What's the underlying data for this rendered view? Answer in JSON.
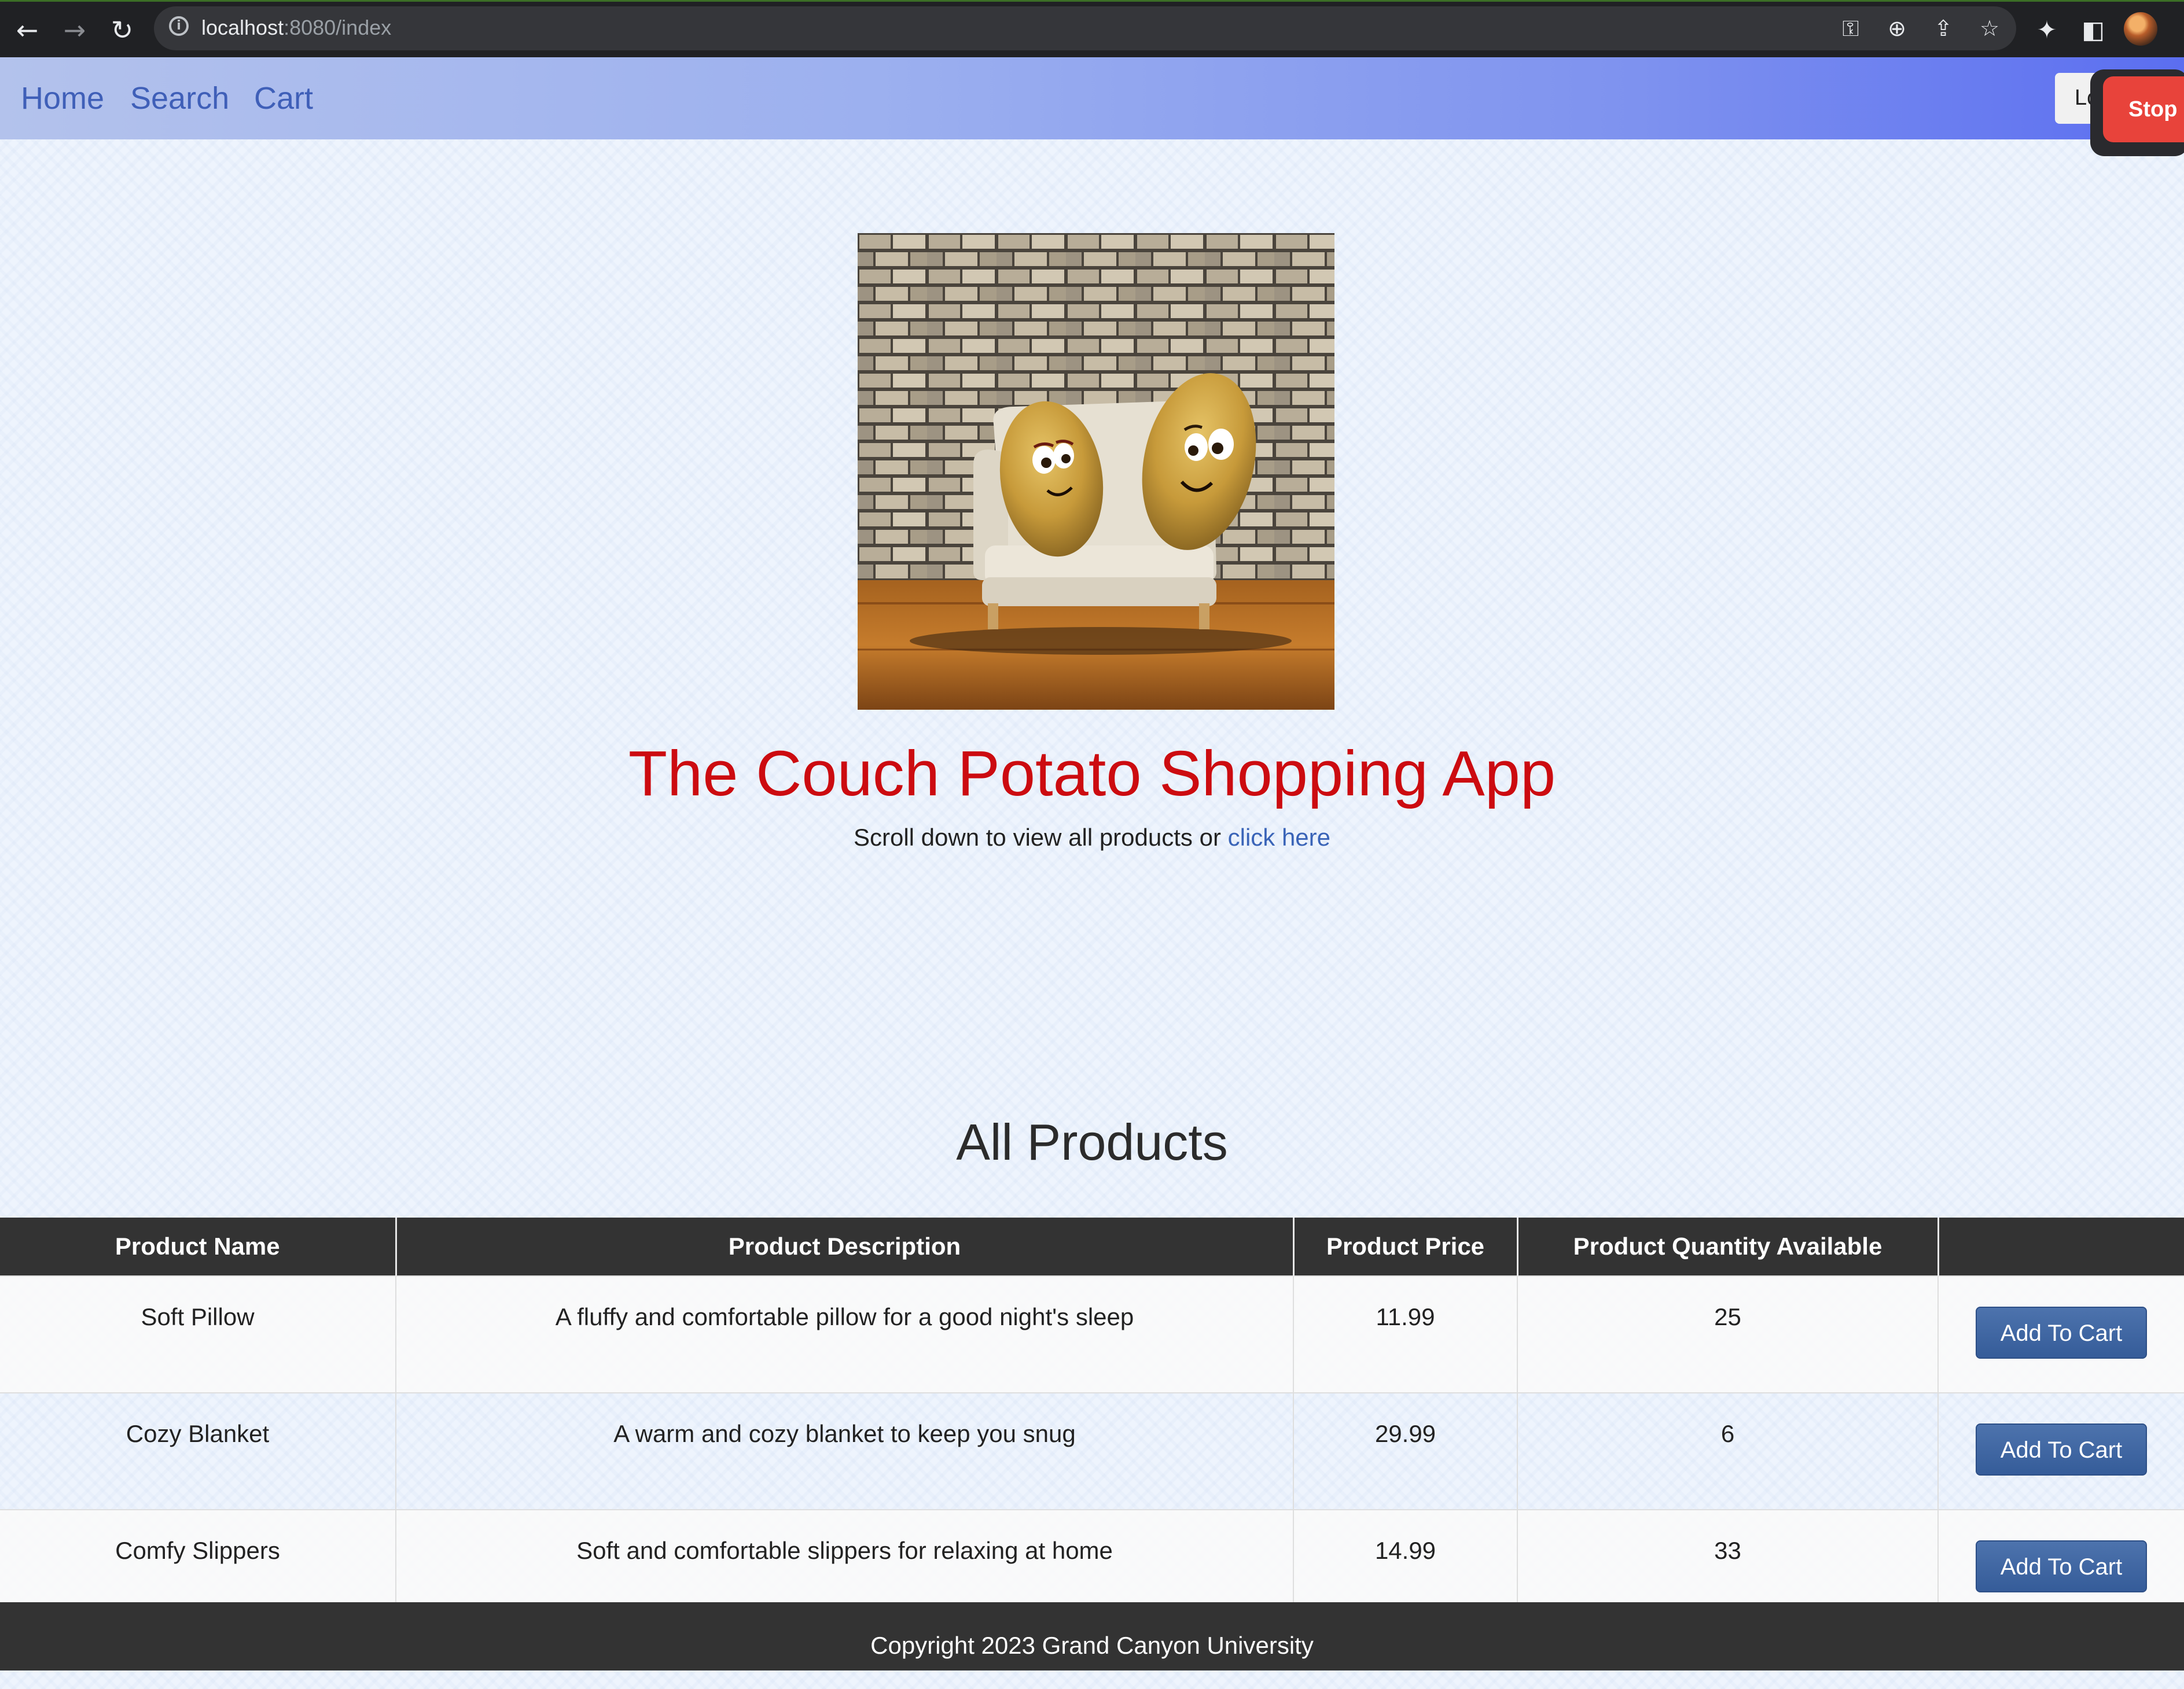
{
  "browser": {
    "url_host": "localhost",
    "url_path": ":8080/index",
    "back_icon": "arrow-left-icon",
    "forward_icon": "arrow-right-icon",
    "reload_icon": "reload-icon"
  },
  "navbar": {
    "links": [
      "Home",
      "Search",
      "Cart"
    ],
    "login_label": "Lo",
    "stop_label": "Stop"
  },
  "hero": {
    "title": "The Couch Potato Shopping App",
    "subtitle_prefix": "Scroll down to view all products or ",
    "subtitle_link": "click here"
  },
  "products": {
    "heading": "All Products",
    "columns": [
      "Product Name",
      "Product Description",
      "Product Price",
      "Product Quantity Available",
      ""
    ],
    "rows": [
      {
        "name": "Soft Pillow",
        "description": "A fluffy and comfortable pillow for a good night's sleep",
        "price": "11.99",
        "quantity": "25",
        "button": "Add To Cart"
      },
      {
        "name": "Cozy Blanket",
        "description": "A warm and cozy blanket to keep you snug",
        "price": "29.99",
        "quantity": "6",
        "button": "Add To Cart"
      },
      {
        "name": "Comfy Slippers",
        "description": "Soft and comfortable slippers for relaxing at home",
        "price": "14.99",
        "quantity": "33",
        "button": "Add To Cart"
      }
    ]
  },
  "footer": {
    "text": "Copyright 2023 Grand Canyon University"
  },
  "colors": {
    "title_red": "#cc0b10",
    "link_blue": "#3a64b8",
    "button_blue": "#355c99",
    "table_header": "#333333",
    "stop_red": "#e8433b"
  }
}
